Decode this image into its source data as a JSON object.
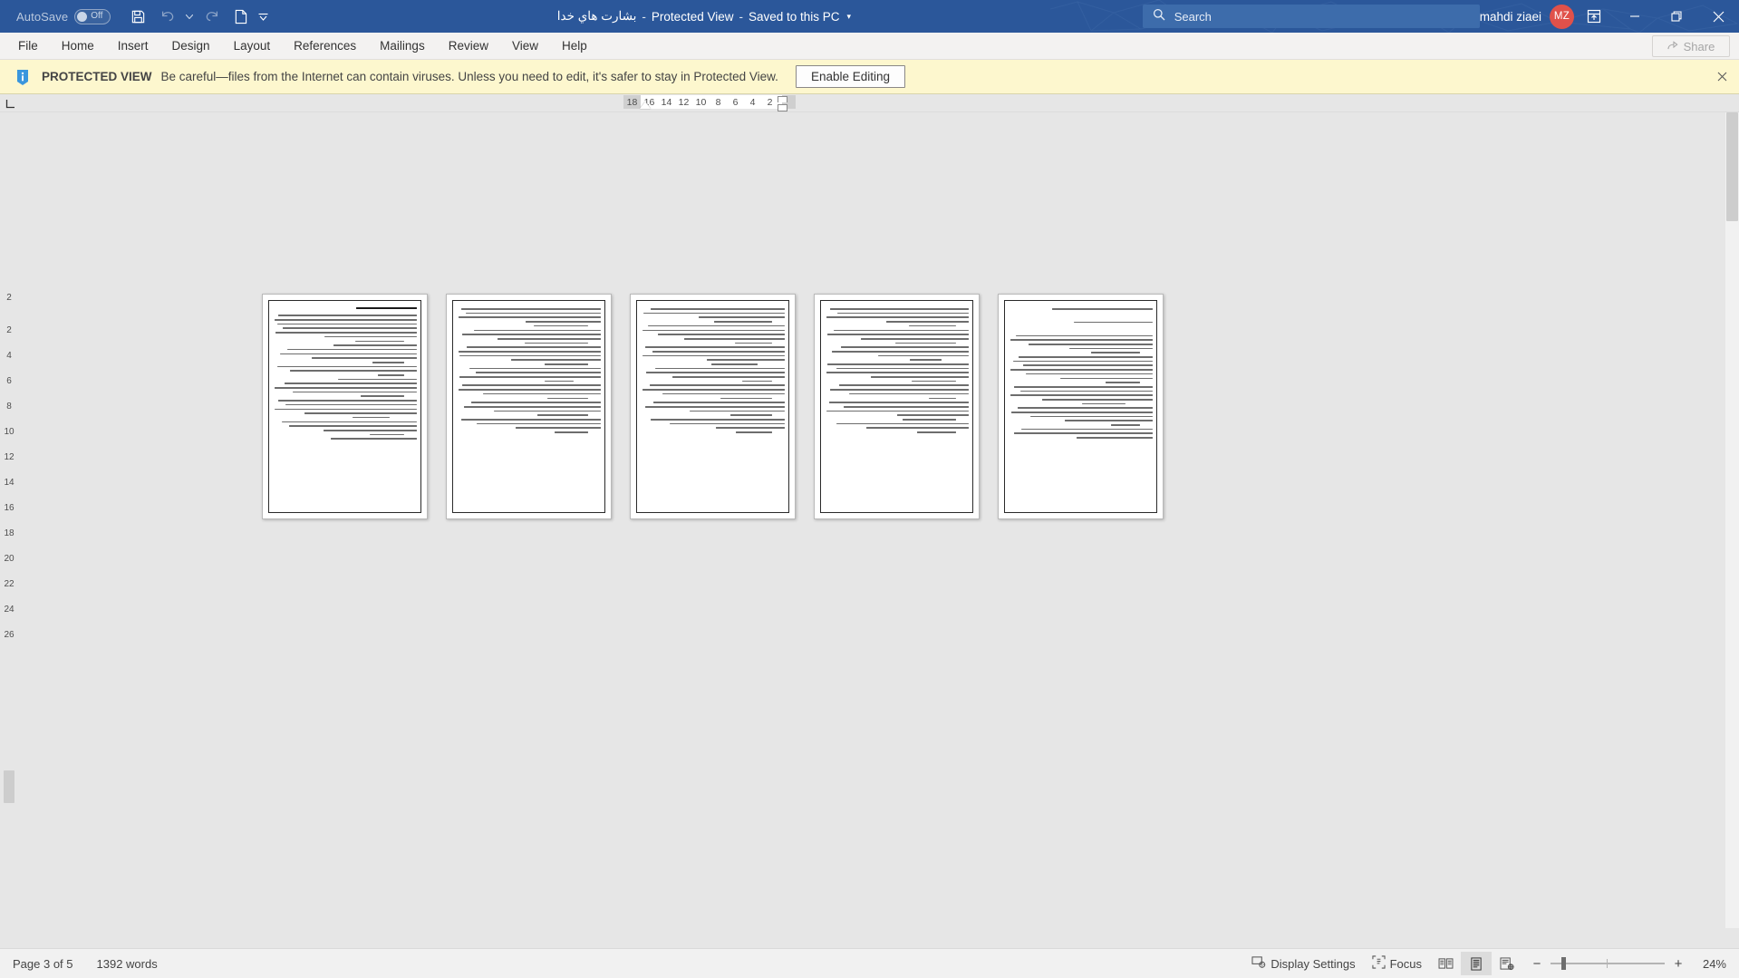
{
  "titlebar": {
    "autosave_label": "AutoSave",
    "autosave_state": "Off",
    "doc_name": "بشارت هاي خدا",
    "sep1": "-",
    "protected_view": "Protected View",
    "sep2": "-",
    "saved_state": "Saved to this PC",
    "caret": "▾",
    "search_placeholder": "Search",
    "user_name": "mahdi ziaei",
    "user_initials": "MZ",
    "icons": {
      "save": "save-icon",
      "undo": "undo-icon",
      "redo": "redo-icon",
      "new": "new-document-icon",
      "customize": "customize-quick-access-toolbar-icon",
      "search": "search-icon",
      "ribbon_display": "ribbon-display-options-icon",
      "minimize": "minimize-icon",
      "restore": "restore-down-icon",
      "close": "close-icon"
    }
  },
  "ribbon": {
    "tabs": [
      "File",
      "Home",
      "Insert",
      "Design",
      "Layout",
      "References",
      "Mailings",
      "Review",
      "View",
      "Help"
    ],
    "share_label": "Share"
  },
  "protected_view": {
    "icon": "info-icon",
    "title": "PROTECTED VIEW",
    "message": "Be careful—files from the Internet can contain viruses. Unless you need to edit, it's safer to stay in Protected View.",
    "enable_button": "Enable Editing",
    "close_icon": "close-icon",
    "background": "#fdf7ce"
  },
  "ruler": {
    "corner_icon": "tab-selector-icon",
    "horizontal_numbers": [
      "18",
      "16",
      "14",
      "12",
      "10",
      "8",
      "6",
      "4",
      "2"
    ],
    "vertical_numbers": [
      "2",
      "2",
      "4",
      "6",
      "8",
      "10",
      "12",
      "14",
      "16",
      "18",
      "20",
      "22",
      "24",
      "26"
    ]
  },
  "document": {
    "pages": [
      {
        "index": 3
      },
      {
        "index": 4
      },
      {
        "index": 5
      },
      {
        "index": 6
      },
      {
        "index": 7
      }
    ],
    "language_direction": "rtl"
  },
  "statusbar": {
    "page_indicator": "Page 3 of 5",
    "word_count": "1392 words",
    "display_settings": "Display Settings",
    "focus": "Focus",
    "zoom_percent": "24%",
    "zoom_out": "−",
    "zoom_in": "+",
    "icons": {
      "display_settings": "display-settings-icon",
      "focus": "focus-icon",
      "read_mode": "read-mode-icon",
      "print_layout": "print-layout-icon",
      "web_layout": "web-layout-icon"
    }
  },
  "colors": {
    "titlebar": "#2b579a",
    "ribbon": "#f3f2f1",
    "banner": "#fdf7ce",
    "workspace": "#e6e6e6",
    "accent_avatar": "#e0514a"
  }
}
